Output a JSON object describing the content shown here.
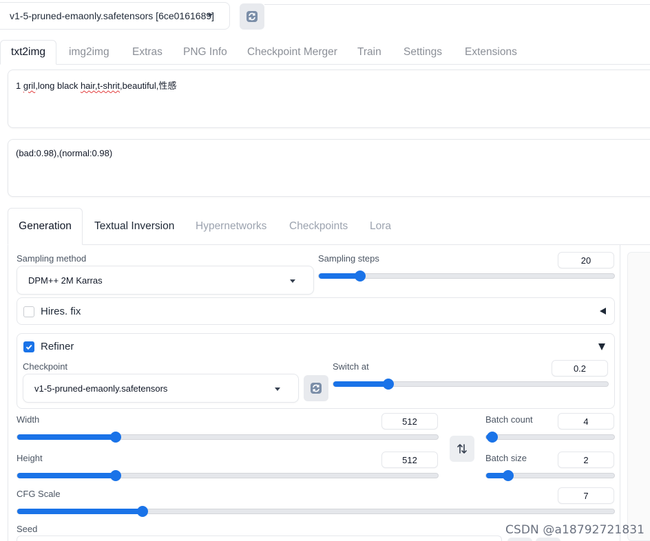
{
  "model": {
    "selected": "v1-5-pruned-emaonly.safetensors [6ce0161689]"
  },
  "top_tabs": [
    "txt2img",
    "img2img",
    "Extras",
    "PNG Info",
    "Checkpoint Merger",
    "Train",
    "Settings",
    "Extensions"
  ],
  "prompt": {
    "pre": "1 ",
    "typo1": "gril",
    "mid": ",long black ",
    "typo2": "hair,t-shrit",
    "post": ",beautiful,性感"
  },
  "negative_prompt": "(bad:0.98),(normal:0.98)",
  "sub_tabs": [
    "Generation",
    "Textual Inversion",
    "Hypernetworks",
    "Checkpoints",
    "Lora"
  ],
  "sampling": {
    "method_label": "Sampling method",
    "method_value": "DPM++ 2M Karras",
    "steps_label": "Sampling steps",
    "steps_value": "20",
    "steps_fraction": 0.14
  },
  "hires": {
    "label": "Hires. fix",
    "checked": false
  },
  "refiner": {
    "label": "Refiner",
    "checked": true,
    "checkpoint_label": "Checkpoint",
    "checkpoint_value": "v1-5-pruned-emaonly.safetensors",
    "switch_label": "Switch at",
    "switch_value": "0.2",
    "switch_fraction": 0.2
  },
  "width": {
    "label": "Width",
    "value": "512",
    "fraction": 0.234
  },
  "height": {
    "label": "Height",
    "value": "512",
    "fraction": 0.234
  },
  "batch_count": {
    "label": "Batch count",
    "value": "4",
    "fraction": 0.05
  },
  "batch_size": {
    "label": "Batch size",
    "value": "2",
    "fraction": 0.17
  },
  "cfg": {
    "label": "CFG Scale",
    "value": "7",
    "fraction": 0.21
  },
  "seed": {
    "label": "Seed"
  },
  "watermark": "CSDN @a18792721831",
  "colors": {
    "accent": "#1a73e8",
    "border": "#e5e7eb",
    "muted_text": "#9ca3af"
  }
}
